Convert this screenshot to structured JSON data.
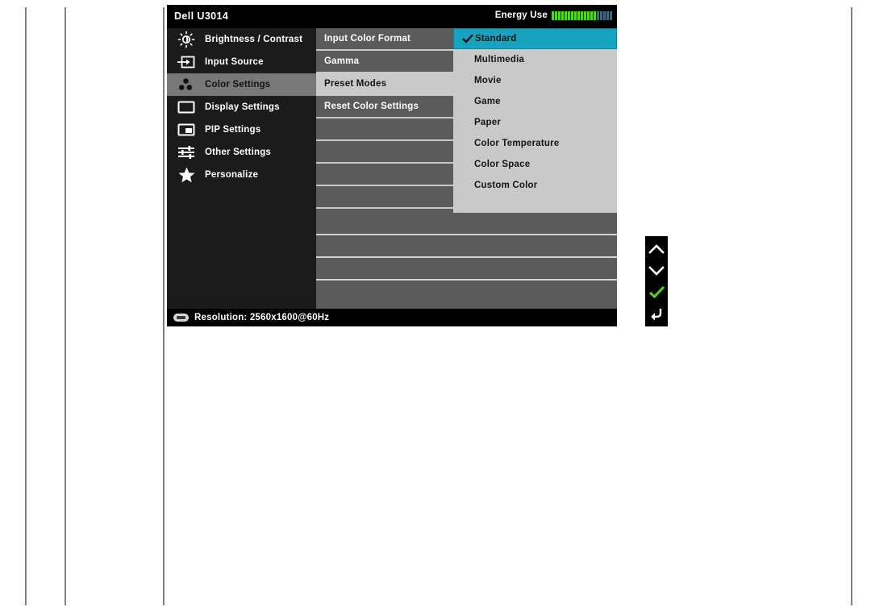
{
  "osd": {
    "title": "Dell U3014",
    "energy": {
      "label": "Energy Use",
      "total_bars": 19,
      "filled_bars": 14,
      "filled_color": "#4cd919",
      "empty_color": "#3d6b7a"
    },
    "sidebar": {
      "items": [
        {
          "label": "Brightness / Contrast",
          "icon": "brightness-icon",
          "active": false
        },
        {
          "label": "Input Source",
          "icon": "input-source-icon",
          "active": false
        },
        {
          "label": "Color Settings",
          "icon": "color-settings-icon",
          "active": true
        },
        {
          "label": "Display Settings",
          "icon": "display-settings-icon",
          "active": false
        },
        {
          "label": "PIP Settings",
          "icon": "pip-settings-icon",
          "active": false
        },
        {
          "label": "Other Settings",
          "icon": "other-settings-icon",
          "active": false
        },
        {
          "label": "Personalize",
          "icon": "personalize-star-icon",
          "active": false
        }
      ]
    },
    "submenu": {
      "items": [
        {
          "label": "Input Color Format",
          "active": false
        },
        {
          "label": "Gamma",
          "active": false
        },
        {
          "label": "Preset Modes",
          "active": true
        },
        {
          "label": "Reset Color Settings",
          "active": false
        },
        {
          "label": "",
          "active": false
        },
        {
          "label": "",
          "active": false
        },
        {
          "label": "",
          "active": false
        },
        {
          "label": "",
          "active": false
        }
      ]
    },
    "presets": {
      "items": [
        {
          "label": "Standard",
          "selected": true
        },
        {
          "label": "Multimedia",
          "selected": false
        },
        {
          "label": "Movie",
          "selected": false
        },
        {
          "label": "Game",
          "selected": false
        },
        {
          "label": "Paper",
          "selected": false
        },
        {
          "label": "Color Temperature",
          "selected": false
        },
        {
          "label": "Color Space",
          "selected": false
        },
        {
          "label": "Custom Color",
          "selected": false
        }
      ],
      "selected_value": "Standard",
      "highlight_color": "#17a3bd",
      "check_icon": "checkmark-icon"
    },
    "status": {
      "icon": "resolution-icon",
      "text": "Resolution: 2560x1600@60Hz"
    }
  },
  "nav": {
    "buttons": [
      {
        "icon": "chevron-up-icon",
        "name": "nav-up-button"
      },
      {
        "icon": "chevron-down-icon",
        "name": "nav-down-button"
      },
      {
        "icon": "check-confirm-icon",
        "name": "nav-confirm-button"
      },
      {
        "icon": "back-arrow-icon",
        "name": "nav-back-button"
      }
    ],
    "confirm_color": "#4cd919"
  }
}
